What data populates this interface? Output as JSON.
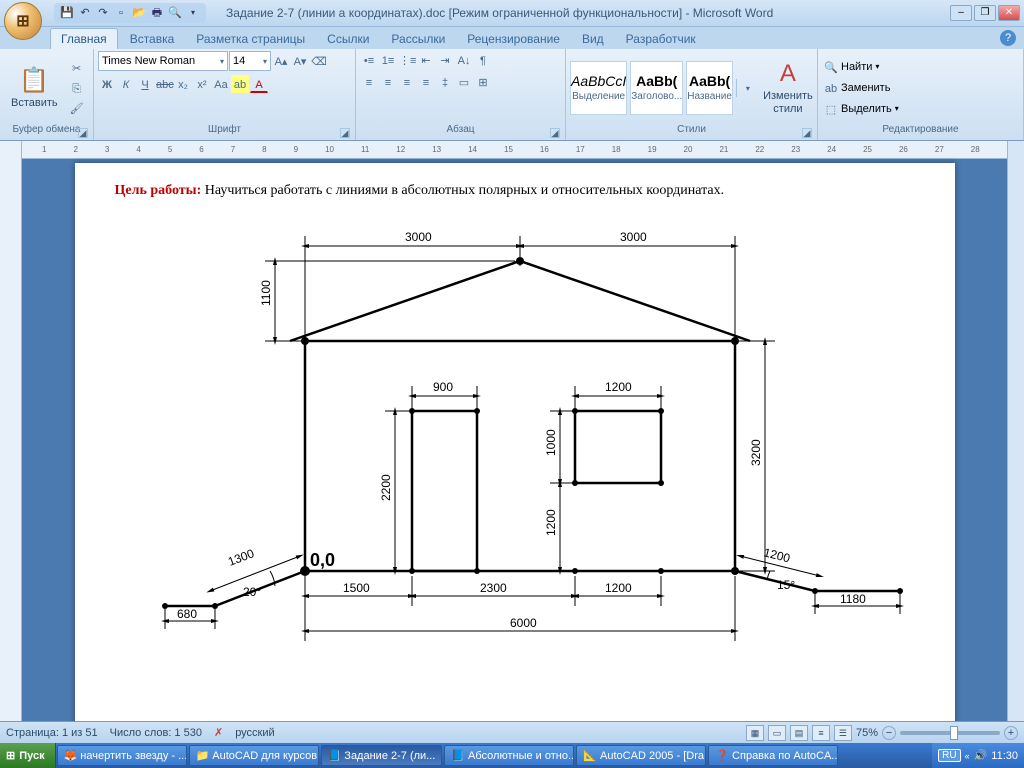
{
  "titlebar": {
    "doc_title": "Задание 2-7 (линии а координатах).doc [Режим ограниченной функциональности] - Microsoft Word"
  },
  "qat": {
    "icons": [
      "save",
      "undo",
      "redo",
      "new",
      "open",
      "print",
      "preview"
    ]
  },
  "tabs": {
    "items": [
      "Главная",
      "Вставка",
      "Разметка страницы",
      "Ссылки",
      "Рассылки",
      "Рецензирование",
      "Вид",
      "Разработчик"
    ],
    "active": 0
  },
  "ribbon": {
    "clipboard": {
      "label": "Буфер обмена",
      "paste": "Вставить"
    },
    "font": {
      "label": "Шрифт",
      "family": "Times New Roman",
      "size": "14",
      "bold": "Ж",
      "italic": "К",
      "underline": "Ч",
      "strike": "abc",
      "sub": "x₂",
      "sup": "x²",
      "case": "Aa",
      "clear": "⌫",
      "highlight": "ab",
      "color": "A"
    },
    "paragraph": {
      "label": "Абзац"
    },
    "styles": {
      "label": "Стили",
      "items": [
        {
          "preview": "AaBbCcI",
          "name": "Выделение",
          "style": "italic"
        },
        {
          "preview": "AaBb(",
          "name": "Заголово...",
          "style": "bold"
        },
        {
          "preview": "AaBb(",
          "name": "Название",
          "style": "bold"
        }
      ],
      "change": "Изменить стили"
    },
    "editing": {
      "label": "Редактирование",
      "find": "Найти",
      "replace": "Заменить",
      "select": "Выделить"
    }
  },
  "document": {
    "goal_label": "Цель работы:",
    "goal_text": "  Научиться  работать  с линиями в  абсолютных полярных и относительных координатах.",
    "drawing": {
      "origin_label": "0,0",
      "dims": {
        "top_left": "3000",
        "top_right": "3000",
        "roof_h": "1100",
        "door_w": "900",
        "door_h": "2200",
        "window_w": "1200",
        "window_h": "1000",
        "window_pos": "1200",
        "wall_h": "3200",
        "bottom_a": "1500",
        "bottom_b": "2300",
        "bottom_c": "1200",
        "bottom_total": "6000",
        "slope_l_len": "1300",
        "slope_l_ang": "20°",
        "slope_l_ext": "680",
        "slope_r_len": "1200",
        "slope_r_ang": "15°",
        "slope_r_ext": "1180"
      }
    }
  },
  "status": {
    "page": "Страница: 1 из 51",
    "words": "Число слов: 1 530",
    "lang": "русский",
    "zoom": "75%"
  },
  "taskbar": {
    "start": "Пуск",
    "items": [
      {
        "icon": "🦊",
        "label": "начертить звезду - ..."
      },
      {
        "icon": "📁",
        "label": "AutoCAD для курсов"
      },
      {
        "icon": "📘",
        "label": "Задание 2-7 (ли...",
        "active": true
      },
      {
        "icon": "📘",
        "label": "Абсолютные и отно..."
      },
      {
        "icon": "📐",
        "label": "AutoCAD 2005 - [Dra..."
      },
      {
        "icon": "❓",
        "label": "Справка по AutoCA..."
      }
    ],
    "lang": "RU",
    "time": "11:30"
  }
}
